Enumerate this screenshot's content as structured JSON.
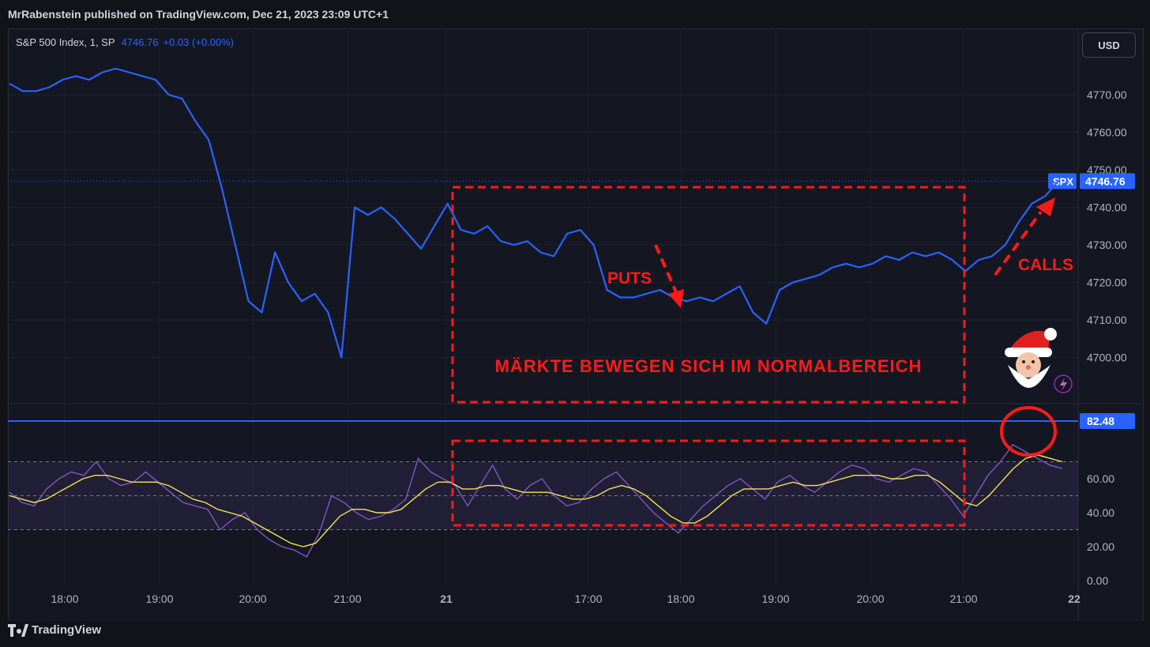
{
  "header": {
    "publisher": "MrRabenstein published on TradingView.com, Dec 21, 2023 23:09 UTC+1"
  },
  "symbol": {
    "label": "S&P 500 Index, 1, SP",
    "price": "4746.76",
    "change": "+0.03 (+0.00%)"
  },
  "currency_button": "USD",
  "footer": {
    "brand": "TradingView"
  },
  "colors": {
    "price_line": "#2962ff",
    "rsi_line": "#7e57c2",
    "rsi_ma": "#f7e15a",
    "annotation": "#ff1a1a",
    "background": "#141722"
  },
  "chart_data": [
    {
      "type": "line",
      "name": "price",
      "ylim": [
        4690,
        4778
      ],
      "y_ticks": [
        "4770.00",
        "4760.00",
        "4750.00",
        "4740.00",
        "4730.00",
        "4720.00",
        "4710.00",
        "4700.00"
      ],
      "x_ticks": [
        "18:00",
        "19:00",
        "20:00",
        "21:00",
        "21",
        "17:00",
        "18:00",
        "19:00",
        "20:00",
        "21:00",
        "22"
      ],
      "last_value_label": {
        "ticker": "SPX",
        "value": "4746.76"
      },
      "series": [
        {
          "values": [
            4773,
            4771,
            4771,
            4772,
            4774,
            4775,
            4774,
            4776,
            4777,
            4776,
            4775,
            4774,
            4770,
            4769,
            4763,
            4758,
            4745,
            4730,
            4715,
            4712,
            4728,
            4720,
            4715,
            4717,
            4712,
            4700,
            4740,
            4738,
            4740,
            4737,
            4733,
            4729,
            4735,
            4741,
            4734,
            4733,
            4735,
            4731,
            4730,
            4731,
            4728,
            4727,
            4733,
            4734,
            4730,
            4718,
            4716,
            4716,
            4717,
            4718,
            4716,
            4715,
            4716,
            4715,
            4717,
            4719,
            4712,
            4709,
            4718,
            4720,
            4721,
            4722,
            4724,
            4725,
            4724,
            4725,
            4727,
            4726,
            4728,
            4727,
            4728,
            4726,
            4723,
            4726,
            4727,
            4730,
            4736,
            4741,
            4743,
            4747
          ]
        }
      ]
    },
    {
      "type": "line",
      "name": "RSI",
      "ylim": [
        0,
        100
      ],
      "y_ticks": [
        "60.00",
        "40.00",
        "20.00",
        "0.00"
      ],
      "bands": [
        30,
        50,
        70
      ],
      "last_value_label": "82.48",
      "series": [
        {
          "name": "RSI",
          "values": [
            52,
            46,
            44,
            54,
            60,
            64,
            62,
            70,
            60,
            56,
            58,
            64,
            58,
            52,
            46,
            44,
            42,
            30,
            36,
            40,
            30,
            24,
            20,
            18,
            14,
            28,
            50,
            46,
            40,
            36,
            38,
            42,
            48,
            72,
            64,
            60,
            56,
            44,
            56,
            68,
            54,
            48,
            56,
            60,
            50,
            44,
            46,
            54,
            60,
            64,
            56,
            48,
            40,
            34,
            28,
            36,
            44,
            50,
            56,
            60,
            54,
            48,
            58,
            62,
            56,
            52,
            58,
            64,
            68,
            66,
            60,
            58,
            62,
            66,
            64,
            56,
            48,
            38,
            50,
            62,
            70,
            80,
            76,
            72,
            68,
            66
          ]
        },
        {
          "name": "MA",
          "values": [
            50,
            48,
            46,
            48,
            52,
            56,
            60,
            62,
            62,
            60,
            58,
            58,
            58,
            56,
            52,
            48,
            46,
            42,
            40,
            38,
            34,
            30,
            26,
            22,
            20,
            22,
            30,
            38,
            42,
            42,
            40,
            40,
            42,
            48,
            54,
            58,
            58,
            54,
            54,
            56,
            56,
            54,
            52,
            52,
            52,
            50,
            48,
            48,
            50,
            54,
            56,
            54,
            50,
            44,
            38,
            34,
            34,
            38,
            44,
            50,
            54,
            54,
            54,
            56,
            58,
            56,
            56,
            58,
            60,
            62,
            62,
            62,
            60,
            60,
            62,
            62,
            58,
            52,
            46,
            44,
            50,
            58,
            66,
            72,
            74,
            72,
            70
          ]
        }
      ]
    }
  ],
  "annotations": {
    "puts": "PUTS",
    "calls": "CALLS",
    "range_text": "MÄRKTE BEWEGEN SICH IM NORMALBEREICH"
  }
}
